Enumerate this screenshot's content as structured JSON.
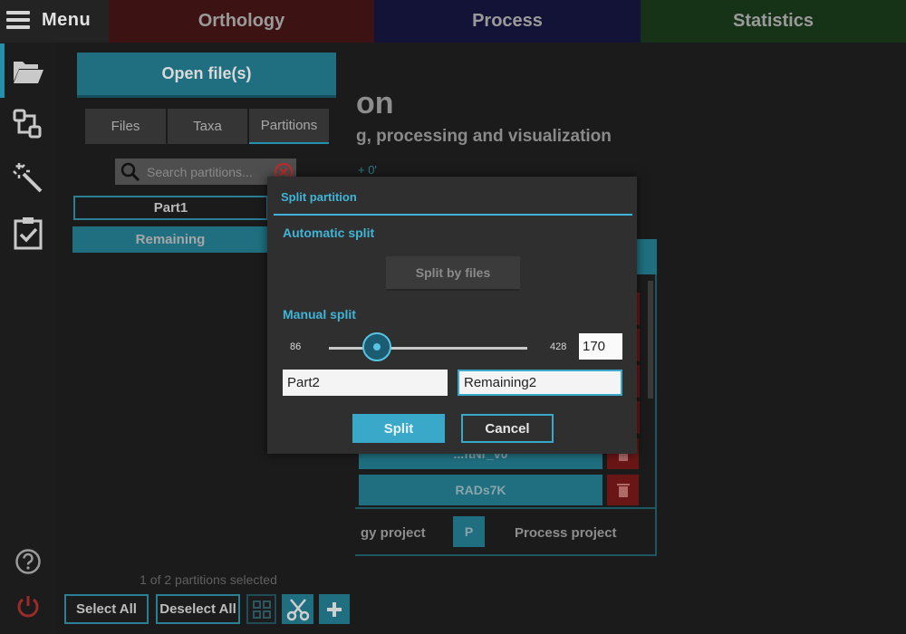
{
  "top_bar": {
    "menu_label": "Menu",
    "tabs": [
      {
        "label": "Orthology"
      },
      {
        "label": "Process"
      },
      {
        "label": "Statistics"
      }
    ]
  },
  "side_panel": {
    "open_files_label": "Open file(s)",
    "sub_tabs": [
      {
        "label": "Files"
      },
      {
        "label": "Taxa"
      },
      {
        "label": "Partitions"
      }
    ],
    "active_sub_tab": "Partitions",
    "search": {
      "placeholder": "Search partitions...",
      "value": ""
    },
    "partitions": [
      {
        "name": "Part1",
        "selected": true
      },
      {
        "name": "Remaining",
        "selected": false
      }
    ],
    "selection_status": "1 of 2 partitions selected",
    "select_all_label": "Select All",
    "deselect_all_label": "Deselect All"
  },
  "main_background": {
    "title_fragment": "on",
    "subtitle_fragment": "g, processing and visualization",
    "counter_fragment": "+ 0'",
    "rows": [
      {
        "label": "...ftNr_v0"
      },
      {
        "label": "RADs7K"
      }
    ],
    "orthology_project_fragment": "gy project",
    "p_badge": "P",
    "process_project_label": "Process project"
  },
  "dialog": {
    "title": "Split partition",
    "automatic_split_label": "Automatic split",
    "split_by_files_label": "Split by files",
    "manual_split_label": "Manual split",
    "slider": {
      "min": "86",
      "max": "428",
      "value": "170"
    },
    "part_name_value": "Part2",
    "remaining_name_value": "Remaining2",
    "split_label": "Split",
    "cancel_label": "Cancel"
  },
  "colors": {
    "accent": "#40b4d6",
    "teal_button": "#1f6f80",
    "orthology_tab": "#3d1212",
    "process_tab": "#131338",
    "statistics_tab": "#173317"
  }
}
